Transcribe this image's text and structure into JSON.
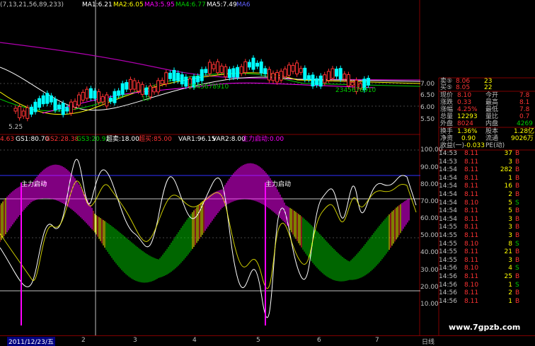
{
  "main_header": {
    "params": "(7,13,21,56,89,233)",
    "ma1": "MA1:6.21",
    "ma2": "MA2:6.05",
    "ma3": "MA3:5.95",
    "ma4": "MA4:6.77",
    "ma5": "MA5:7.49",
    "ma6": "MA6"
  },
  "price_annotations": {
    "low": "5.25",
    "seq1": "2345678910",
    "seq2": "2345678910",
    "seq3": "1",
    "seq4": "10"
  },
  "price_axis": [
    "7.00",
    "6.50",
    "6.00",
    "5.50"
  ],
  "indicator_header": {
    "v0": "4.63",
    "gs1": "GS1:80.70",
    "gs2": "GS2:28.38",
    "gs3": "GS3:20.91",
    "chaomai": "超卖:18.00",
    "chaomai2": "超买:85.00",
    "var1": "VAR1:96.15",
    "var2": "VAR2:8.00",
    "zhuli": "主力启动:0.00"
  },
  "indicator_labels": {
    "start1": "主力启动",
    "start2": "主力启动",
    "start3": "主力启动"
  },
  "indicator_axis": [
    "100.00",
    "90.00",
    "80.00",
    "70.00",
    "60.00",
    "50.00",
    "40.00",
    "30.00",
    "20.00",
    "10.00"
  ],
  "quote": {
    "sell5": {
      "label": "卖⑤",
      "price": "8.06",
      "vol": "23"
    },
    "buy5": {
      "label": "买⑤",
      "price": "8.05",
      "vol": "22"
    },
    "rows": [
      {
        "l1": "现价",
        "v1": "8.10",
        "l2": "今开",
        "v2": "7.8"
      },
      {
        "l1": "涨跌",
        "v1": "0.33",
        "l2": "最高",
        "v2": "8.1"
      },
      {
        "l1": "涨幅",
        "v1": "4.25%",
        "l2": "最低",
        "v2": "7.8"
      },
      {
        "l1": "总量",
        "v1": "12293",
        "l2": "量比",
        "v2": "0.7"
      },
      {
        "l1": "外盘",
        "v1": "8024",
        "l2": "内盘",
        "v2": "4269"
      }
    ],
    "rows2": [
      {
        "l1": "换手",
        "v1": "1.36%",
        "l2": "股本",
        "v2": "1.28亿"
      },
      {
        "l1": "净资",
        "v1": "0.90",
        "l2": "流通",
        "v2": "9026万"
      },
      {
        "l1": "收益(一)",
        "v1": "-0.033",
        "l2": "PE(动)",
        "v2": ""
      }
    ]
  },
  "ticks": [
    {
      "time": "14:53",
      "price": "8.11",
      "vol": "37",
      "dir": "B",
      "extra": ""
    },
    {
      "time": "14:53",
      "price": "8.11",
      "vol": "3",
      "dir": "B",
      "extra": ""
    },
    {
      "time": "14:54",
      "price": "8.11",
      "vol": "282",
      "dir": "B",
      "extra": ""
    },
    {
      "time": "14:54",
      "price": "8.11",
      "vol": "1",
      "dir": "B",
      "extra": ""
    },
    {
      "time": "14:54",
      "price": "8.11",
      "vol": "16",
      "dir": "B",
      "extra": ""
    },
    {
      "time": "14:54",
      "price": "8.11",
      "vol": "2",
      "dir": "B",
      "extra": ""
    },
    {
      "time": "14:54",
      "price": "8.10",
      "vol": "5",
      "dir": "S",
      "extra": ""
    },
    {
      "time": "14:54",
      "price": "8.11",
      "vol": "5",
      "dir": "B",
      "extra": ""
    },
    {
      "time": "14:54",
      "price": "8.11",
      "vol": "3",
      "dir": "B",
      "extra": ""
    },
    {
      "time": "14:55",
      "price": "8.11",
      "vol": "3",
      "dir": "B",
      "extra": ""
    },
    {
      "time": "14:55",
      "price": "8.11",
      "vol": "3",
      "dir": "B",
      "extra": ""
    },
    {
      "time": "14:55",
      "price": "8.10",
      "vol": "8",
      "dir": "S",
      "extra": ""
    },
    {
      "time": "14:55",
      "price": "8.11",
      "vol": "21",
      "dir": "B",
      "extra": ""
    },
    {
      "time": "14:55",
      "price": "8.11",
      "vol": "3",
      "dir": "B",
      "extra": ""
    },
    {
      "time": "14:56",
      "price": "8.10",
      "vol": "4",
      "dir": "S",
      "extra": ""
    },
    {
      "time": "14:56",
      "price": "8.11",
      "vol": "25",
      "dir": "B",
      "extra": ""
    },
    {
      "time": "14:56",
      "price": "8.10",
      "vol": "1",
      "dir": "S",
      "extra": ""
    },
    {
      "time": "14:56",
      "price": "8.11",
      "vol": "2",
      "dir": "B",
      "extra": ""
    },
    {
      "time": "14:56",
      "price": "8.11",
      "vol": "1",
      "dir": "B",
      "extra": ""
    }
  ],
  "bottom_axis": {
    "date": "2011/12/23/五",
    "m2": "2",
    "m3": "3",
    "m4": "4",
    "m5": "5",
    "m6": "6",
    "m7": "7",
    "tab": "日线"
  },
  "watermark": "www.7gpzb.com",
  "colors": {
    "up": "#ff3333",
    "down": "#00ffff",
    "green": "#00cc00",
    "magenta": "#ff00ff",
    "yellow": "#ffff00",
    "frame": "#800000"
  }
}
